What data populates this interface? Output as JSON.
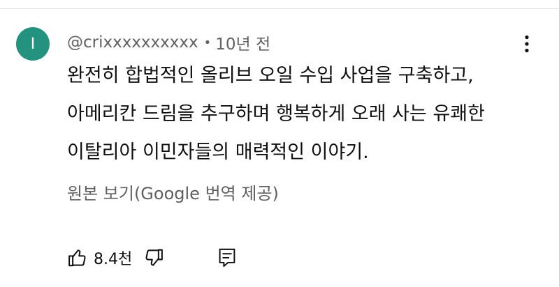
{
  "comment": {
    "avatar_letter": "I",
    "avatar_color": "#23937f",
    "author": "@crixxxxxxxxxx",
    "separator": "•",
    "time": "10년 전",
    "lines": [
      "완전히 합법적인 올리브 오일 수입 사업을 구축하고,",
      "아메리칸 드림을 추구하며 행복하게 오래 사는 유쾌한",
      "이탈리아 이민자들의 매력적인 이야기."
    ],
    "translate_label": "원본 보기(Google 번역 제공)",
    "like_count": "8.4천"
  },
  "icons": {
    "more": "more-vert-icon",
    "like": "thumb-up-icon",
    "dislike": "thumb-down-icon",
    "reply": "reply-comment-icon"
  }
}
